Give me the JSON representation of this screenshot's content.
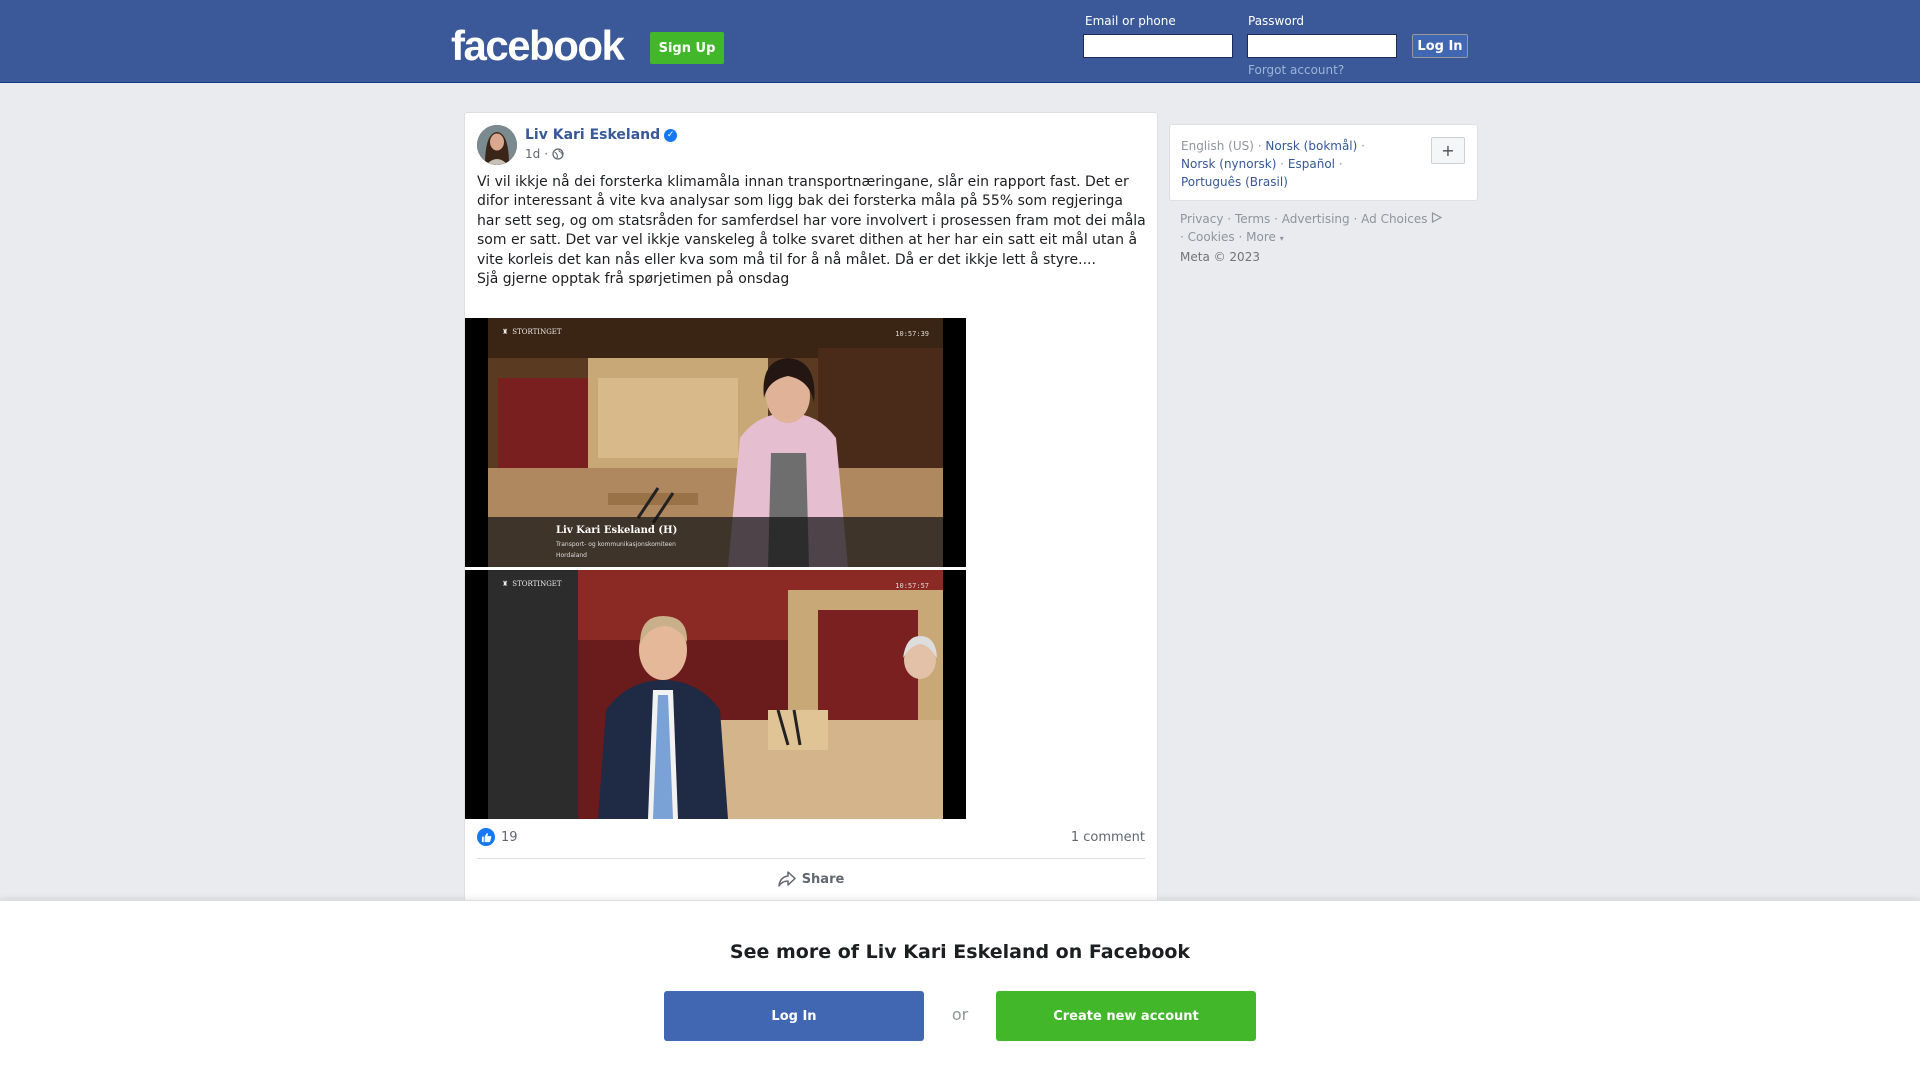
{
  "header": {
    "logo": "facebook",
    "signup_label": "Sign Up",
    "email_label": "Email or phone",
    "password_label": "Password",
    "login_label": "Log In",
    "forgot_label": "Forgot account?"
  },
  "post": {
    "author": "Liv Kari Eskeland",
    "time": "1d",
    "separator": "·",
    "text_lines": [
      "Vi vil ikkje nå dei forsterka klimamåla innan transportnæringane, slår ein rapport fast. Det er difor interessant å vite kva analysar som ligg bak dei forsterka måla på 55% som regjeringa har sett seg, og om statsråden for samferdsel har vore involvert i prosessen fram mot dei måla som er satt. Det var vel ikkje vanskeleg å tolke svaret dithen at her har ein satt eit mål utan å vite korleis det kan nås eller kva som må til for å nå målet. Då er det ikkje lett å styre....",
      "Sjå gjerne opptak frå spørjetimen på onsdag"
    ],
    "video1": {
      "channel": "STORTINGET",
      "timestamp": "10:57:39",
      "name": "Liv Kari Eskeland (H)",
      "committee": "Transport- og kommunikasjonskomiteen",
      "region": "Hordaland"
    },
    "video2": {
      "channel": "STORTINGET",
      "timestamp": "10:57:57"
    },
    "like_count": "19",
    "comments_label": "1 comment",
    "share_label": "Share"
  },
  "sidebar": {
    "lang_current": "English (US)",
    "lang_links": [
      "Norsk (bokmål)",
      "Norsk (nynorsk)",
      "Español",
      "Português (Brasil)"
    ],
    "lang_sep": "·",
    "plus_label": "+",
    "footer_links": [
      "Privacy",
      "Terms",
      "Advertising",
      "Ad Choices",
      "Cookies",
      "More"
    ],
    "copyright": "Meta © 2023"
  },
  "overlay": {
    "title": "See more of Liv Kari Eskeland on Facebook",
    "login_label": "Log In",
    "or_label": "or",
    "create_label": "Create new account"
  },
  "colors": {
    "header_blue": "#3b5998",
    "link_blue": "#385898",
    "green": "#42b72a",
    "login_blue": "#4267b2"
  }
}
